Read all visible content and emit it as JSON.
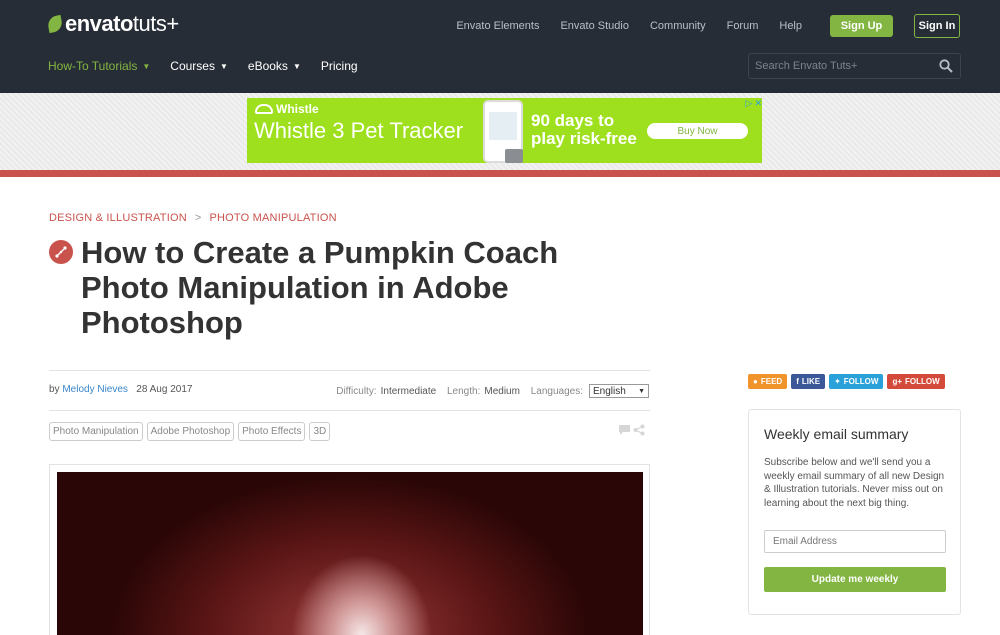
{
  "header": {
    "logo_brand": "envato",
    "logo_suffix": "tuts+",
    "top_links": [
      "Envato Elements",
      "Envato Studio",
      "Community",
      "Forum",
      "Help"
    ],
    "signup_label": "Sign Up",
    "signin_label": "Sign In",
    "nav": [
      {
        "label": "How-To Tutorials",
        "has_menu": true,
        "active": true
      },
      {
        "label": "Courses",
        "has_menu": true
      },
      {
        "label": "eBooks",
        "has_menu": true
      },
      {
        "label": "Pricing",
        "has_menu": false
      }
    ],
    "search_placeholder": "Search Envato Tuts+"
  },
  "ad": {
    "brand": "Whistle",
    "title": "Whistle 3 Pet Tracker",
    "offer_line1": "90 days to",
    "offer_line2": "play risk-free",
    "cta": "Buy Now",
    "background": "#9fe01e"
  },
  "article": {
    "breadcrumb": [
      "DESIGN & ILLUSTRATION",
      "PHOTO MANIPULATION"
    ],
    "breadcrumb_sep": ">",
    "title": "How to Create a Pumpkin Coach Photo Manipulation in Adobe Photoshop",
    "byline_prefix": "by",
    "author": "Melody Nieves",
    "date": "28 Aug 2017",
    "difficulty_label": "Difficulty:",
    "difficulty": "Intermediate",
    "length_label": "Length:",
    "length": "Medium",
    "languages_label": "Languages:",
    "language": "English",
    "tags": [
      "Photo Manipulation",
      "Adobe Photoshop",
      "Photo Effects",
      "3D"
    ]
  },
  "sidebar": {
    "social": [
      {
        "label": "FEED",
        "icon": "rss-icon",
        "color": "#f0932b"
      },
      {
        "label": "LIKE",
        "icon": "facebook-icon",
        "color": "#3b5998"
      },
      {
        "label": "FOLLOW",
        "icon": "twitter-icon",
        "color": "#2aa1d8"
      },
      {
        "label": "FOLLOW",
        "icon": "google-plus-icon",
        "color": "#d44a3a"
      }
    ],
    "newsletter": {
      "title": "Weekly email summary",
      "text": "Subscribe below and we'll send you a weekly email summary of all new Design & Illustration tutorials. Never miss out on learning about the next big thing.",
      "email_placeholder": "Email Address",
      "button": "Update me weekly"
    }
  },
  "colors": {
    "header_bg": "#272d36",
    "accent_green": "#82b541",
    "accent_red": "#c9524c",
    "link_blue": "#3a86c9"
  }
}
